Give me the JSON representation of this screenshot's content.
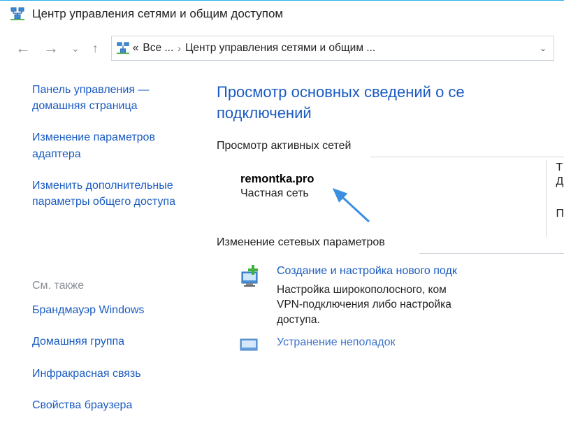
{
  "window": {
    "title": "Центр управления сетями и общим доступом"
  },
  "breadcrumb": {
    "prefix": "«",
    "seg1": "Все ...",
    "seg2": "Центр управления сетями и общим ..."
  },
  "sidebar": {
    "home": "Панель управления — домашняя страница",
    "adapter": "Изменение параметров адаптера",
    "sharing": "Изменить дополнительные параметры общего доступа",
    "see_also": "См. также",
    "firewall": "Брандмауэр Windows",
    "homegroup": "Домашняя группа",
    "infrared": "Инфракрасная связь",
    "browser": "Свойства браузера"
  },
  "main": {
    "heading": "Просмотр основных сведений о сети и настройка подключений",
    "heading_line1": "Просмотр основных сведений о се",
    "heading_line2": "подключений",
    "active_networks": "Просмотр активных сетей",
    "network_name": "remontka.pro",
    "network_type": "Частная сеть",
    "right_t": "Т",
    "right_d": "Д",
    "right_p": "П",
    "change_settings": "Изменение сетевых параметров",
    "task1_link": "Создание и настройка нового подк",
    "task1_desc1": "Настройка широкополосного, ком",
    "task1_desc2": "VPN-подключения либо настройка",
    "task1_desc3": "доступа.",
    "task2_link": "Устранение неполадок"
  }
}
